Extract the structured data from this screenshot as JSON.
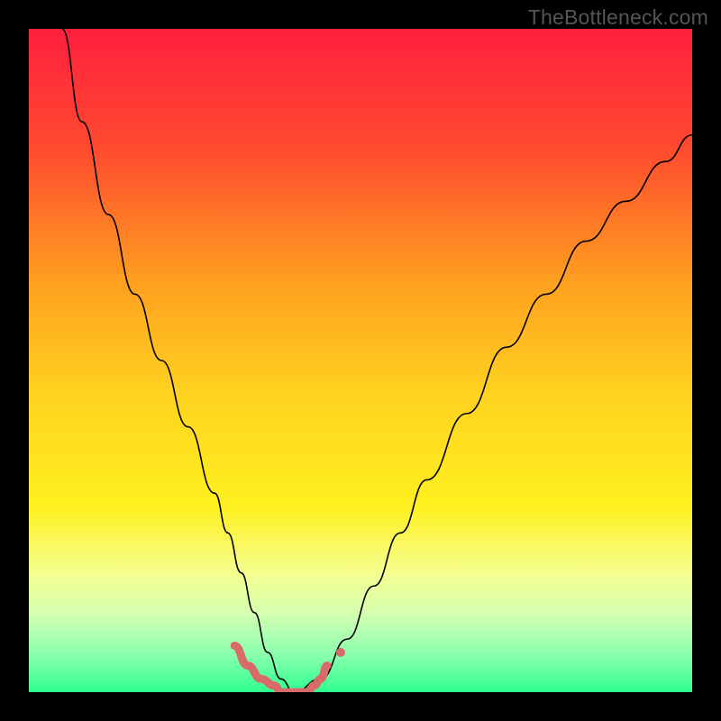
{
  "watermark": "TheBottleneck.com",
  "chart_data": {
    "type": "line",
    "title": "",
    "xlabel": "",
    "ylabel": "",
    "xlim": [
      0,
      100
    ],
    "ylim": [
      0,
      100
    ],
    "grid": false,
    "legend": false,
    "background_gradient": {
      "stops": [
        {
          "offset": 0.0,
          "color": "#ff1f3f"
        },
        {
          "offset": 0.18,
          "color": "#ff4a2f"
        },
        {
          "offset": 0.38,
          "color": "#ff9f1f"
        },
        {
          "offset": 0.55,
          "color": "#ffd21f"
        },
        {
          "offset": 0.72,
          "color": "#fff01f"
        },
        {
          "offset": 0.82,
          "color": "#f6ff8f"
        },
        {
          "offset": 0.88,
          "color": "#d6ffb0"
        },
        {
          "offset": 0.94,
          "color": "#8fffb0"
        },
        {
          "offset": 1.0,
          "color": "#2fff8f"
        }
      ]
    },
    "series": [
      {
        "name": "curve",
        "stroke": "#000000",
        "stroke_width": 1.6,
        "x": [
          5,
          8,
          12,
          16,
          20,
          24,
          28,
          30,
          32,
          34,
          36,
          38,
          40,
          44,
          48,
          52,
          56,
          60,
          66,
          72,
          78,
          84,
          90,
          96,
          100
        ],
        "values": [
          100,
          86,
          72,
          60,
          50,
          40,
          30,
          24,
          18,
          12,
          6,
          2,
          0,
          2,
          8,
          16,
          24,
          32,
          42,
          52,
          60,
          68,
          74,
          80,
          84
        ]
      },
      {
        "name": "highlight",
        "stroke": "#d86a6a",
        "stroke_width": 9,
        "linecap": "round",
        "x": [
          31,
          33,
          35,
          37,
          38,
          39,
          40,
          41,
          42,
          43,
          44,
          45
        ],
        "values": [
          7,
          4,
          2,
          1,
          0,
          0,
          0,
          0,
          0,
          1,
          2,
          4
        ]
      }
    ],
    "points": [
      {
        "name": "marker",
        "x": 47,
        "y": 6,
        "r": 5,
        "fill": "#d86a6a"
      }
    ]
  }
}
